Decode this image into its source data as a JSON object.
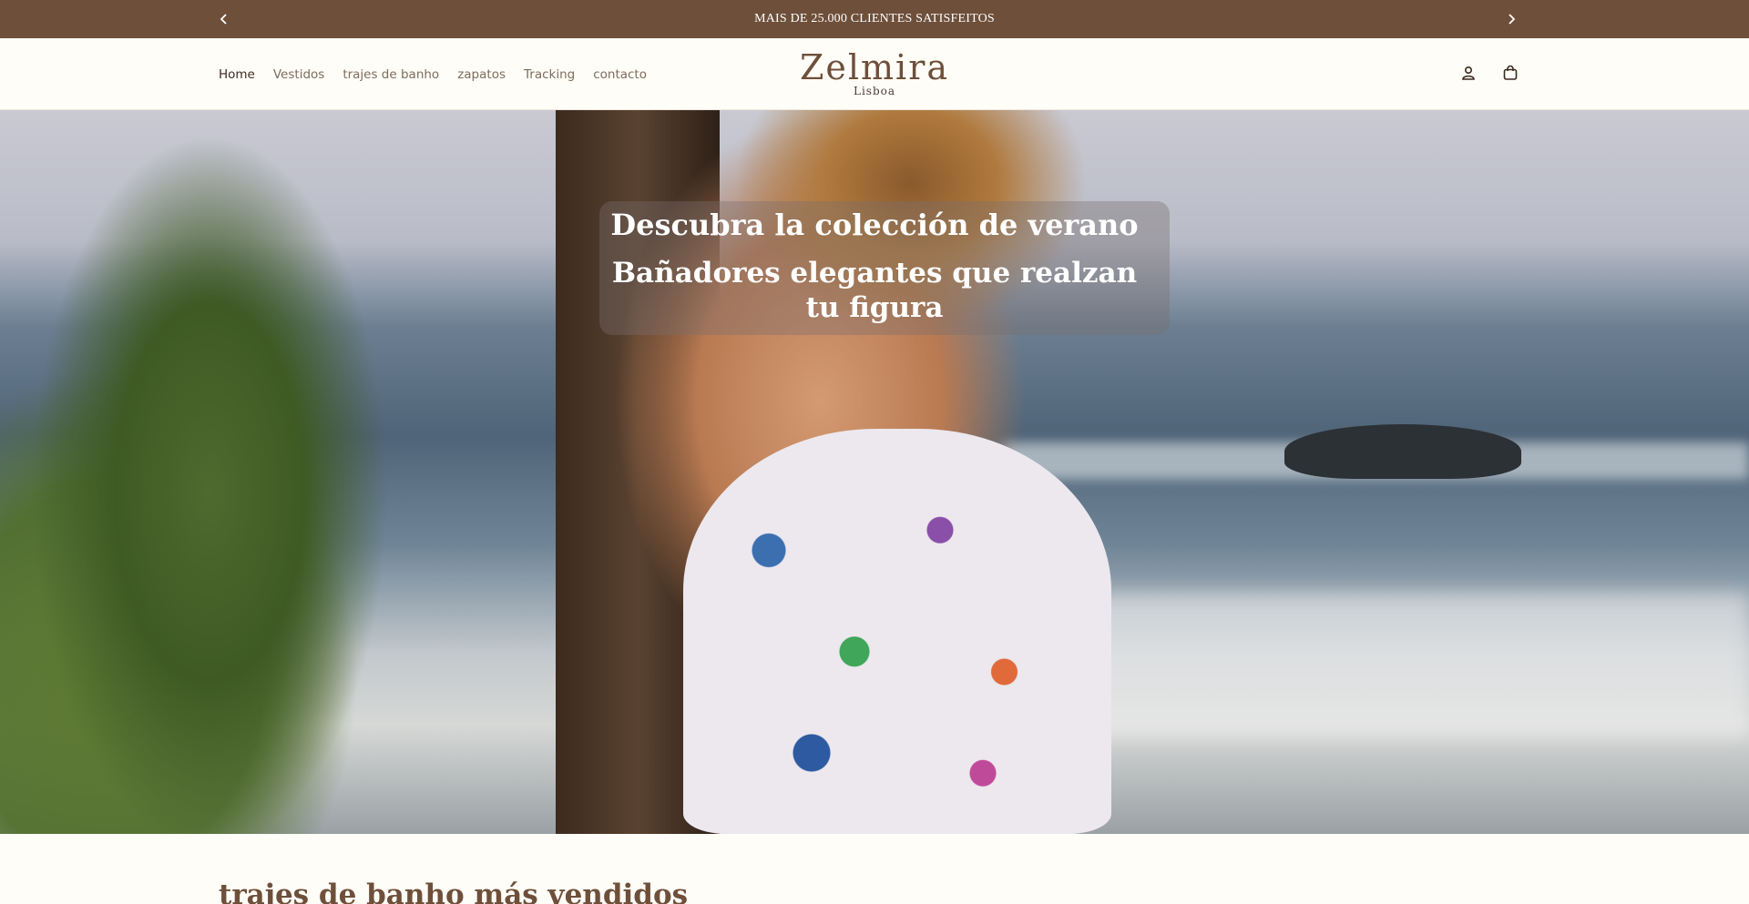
{
  "announcement": {
    "message": "MAIS DE 25.000 CLIENTES SATISFEITOS",
    "prev_icon": "chevron-left-icon",
    "next_icon": "chevron-right-icon"
  },
  "header": {
    "nav": [
      {
        "label": "Home",
        "active": true
      },
      {
        "label": "Vestidos"
      },
      {
        "label": "trajes de banho"
      },
      {
        "label": "zapatos"
      },
      {
        "label": "Tracking"
      },
      {
        "label": "contacto"
      }
    ],
    "logo": {
      "brand": "Zelmira",
      "city": "Lisboa"
    },
    "icons": [
      "account-icon",
      "cart-icon"
    ]
  },
  "hero": {
    "title": "Descubra la colección de verano",
    "subtitle": "Bañadores elegantes que realzan tu figura"
  },
  "section": {
    "title": "trajes de banho más vendidos"
  },
  "colors": {
    "brand": "#6e4f3a",
    "background": "#fffdf7"
  }
}
